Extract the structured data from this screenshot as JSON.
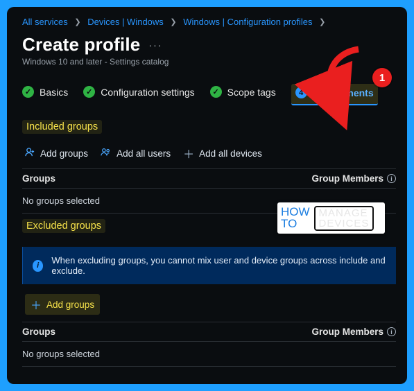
{
  "breadcrumb": {
    "items": [
      "All services",
      "Devices | Windows",
      "Windows | Configuration profiles"
    ]
  },
  "header": {
    "title": "Create profile",
    "subtitle": "Windows 10 and later - Settings catalog"
  },
  "steps": {
    "basics": "Basics",
    "config": "Configuration settings",
    "scope": "Scope tags",
    "assign_num": "4",
    "assign": "Assignments"
  },
  "included": {
    "title": "Included groups",
    "add_groups": "Add groups",
    "add_all_users": "Add all users",
    "add_all_devices": "Add all devices",
    "col_groups": "Groups",
    "col_members": "Group Members",
    "empty": "No groups selected"
  },
  "excluded": {
    "title": "Excluded groups",
    "banner": "When excluding groups, you cannot mix user and device groups across include and exclude.",
    "add_groups": "Add groups",
    "col_groups": "Groups",
    "col_members": "Group Members",
    "empty": "No groups selected"
  },
  "annotation": {
    "badge": "1"
  },
  "watermark": {
    "how": "HOW",
    "to": "TO",
    "manage": "MANAGE",
    "devices": "DEVICES"
  }
}
